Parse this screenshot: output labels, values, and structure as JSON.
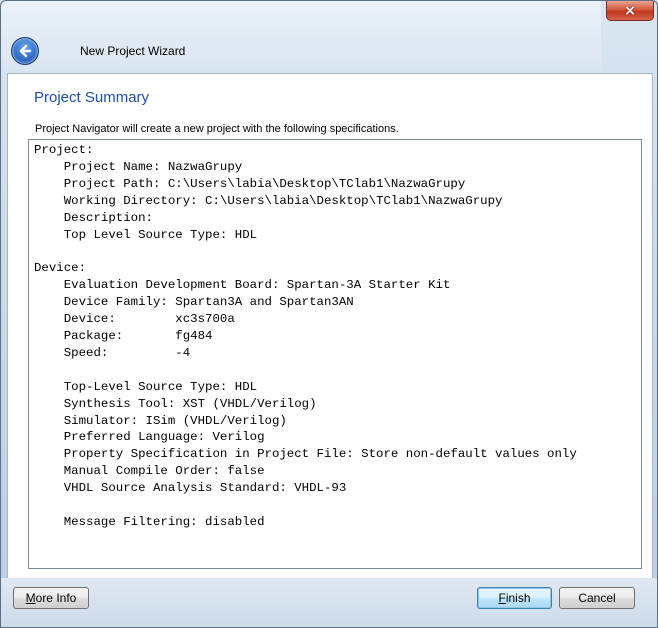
{
  "window": {
    "title": "New Project Wizard",
    "close_glyph": "×",
    "back_icon": "back-arrow-icon"
  },
  "page": {
    "title": "Project Summary",
    "intro": "Project Navigator will create a new project with the following specifications."
  },
  "summary_lines": [
    "Project:",
    "    Project Name: NazwaGrupy",
    "    Project Path: C:\\Users\\labia\\Desktop\\TClab1\\NazwaGrupy",
    "    Working Directory: C:\\Users\\labia\\Desktop\\TClab1\\NazwaGrupy",
    "    Description:",
    "    Top Level Source Type: HDL",
    "",
    "Device:",
    "    Evaluation Development Board: Spartan-3A Starter Kit",
    "    Device Family: Spartan3A and Spartan3AN",
    "    Device:        xc3s700a",
    "    Package:       fg484",
    "    Speed:         -4",
    "",
    "    Top-Level Source Type: HDL",
    "    Synthesis Tool: XST (VHDL/Verilog)",
    "    Simulator: ISim (VHDL/Verilog)",
    "    Preferred Language: Verilog",
    "    Property Specification in Project File: Store non-default values only",
    "    Manual Compile Order: false",
    "    VHDL Source Analysis Standard: VHDL-93",
    "",
    "    Message Filtering: disabled"
  ],
  "buttons": {
    "more_info_first": "M",
    "more_info_rest": "ore Info",
    "finish_first": "F",
    "finish_rest": "inish",
    "cancel": "Cancel"
  }
}
